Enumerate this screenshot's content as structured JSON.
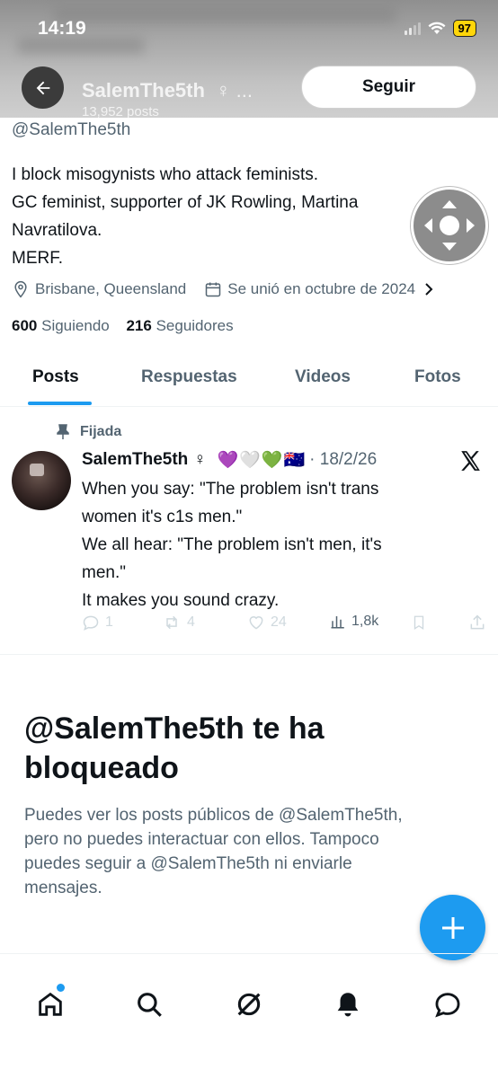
{
  "status_bar": {
    "time": "14:19",
    "battery": "97"
  },
  "header": {
    "name": "SalemThe5th",
    "name_suffix": "♀ ...",
    "posts_count": "13,952 posts",
    "follow_label": "Seguir"
  },
  "profile": {
    "handle": "@SalemThe5th",
    "bio_lines": [
      "I block misogynists who attack feminists.",
      "GC feminist, supporter of JK Rowling, Martina",
      "Navratilova.",
      "MERF."
    ],
    "location": "Brisbane, Queensland",
    "joined": "Se unió en octubre de 2024",
    "following_count": "600",
    "following_label": "Siguiendo",
    "followers_count": "216",
    "followers_label": "Seguidores"
  },
  "tabs": [
    "Posts",
    "Respuestas",
    "Videos",
    "Fotos"
  ],
  "post": {
    "pinned_label": "Fijada",
    "author": "SalemThe5th",
    "author_symbol": "♀",
    "emojis": "💜🤍💚🇦🇺",
    "date": "· 18/2/26",
    "text_lines": [
      "When you say: \"The problem isn't trans",
      "women it's c1s men.\"",
      "We all hear: \"The problem isn't men, it's",
      "men.\"",
      "It makes you sound crazy."
    ],
    "replies": "1",
    "reposts": "4",
    "likes": "24",
    "views": "1,8k"
  },
  "blocked": {
    "title_lines": [
      "@SalemThe5th te ha",
      "bloqueado"
    ],
    "desc_lines": [
      "Puedes ver los posts públicos de @SalemThe5th,",
      "pero no puedes interactuar con ellos. Tampoco",
      "puedes seguir a @SalemThe5th ni enviarle",
      "mensajes."
    ]
  },
  "colors": {
    "accent": "#1d9bf0",
    "text": "#0f1419",
    "muted": "#536471"
  },
  "icons": {
    "nav": [
      "home-icon",
      "search-icon",
      "grok-icon",
      "notifications-icon",
      "messages-icon"
    ],
    "post_actions": [
      "reply-icon",
      "repost-icon",
      "like-icon",
      "views-icon",
      "bookmark-icon",
      "share-icon"
    ]
  }
}
